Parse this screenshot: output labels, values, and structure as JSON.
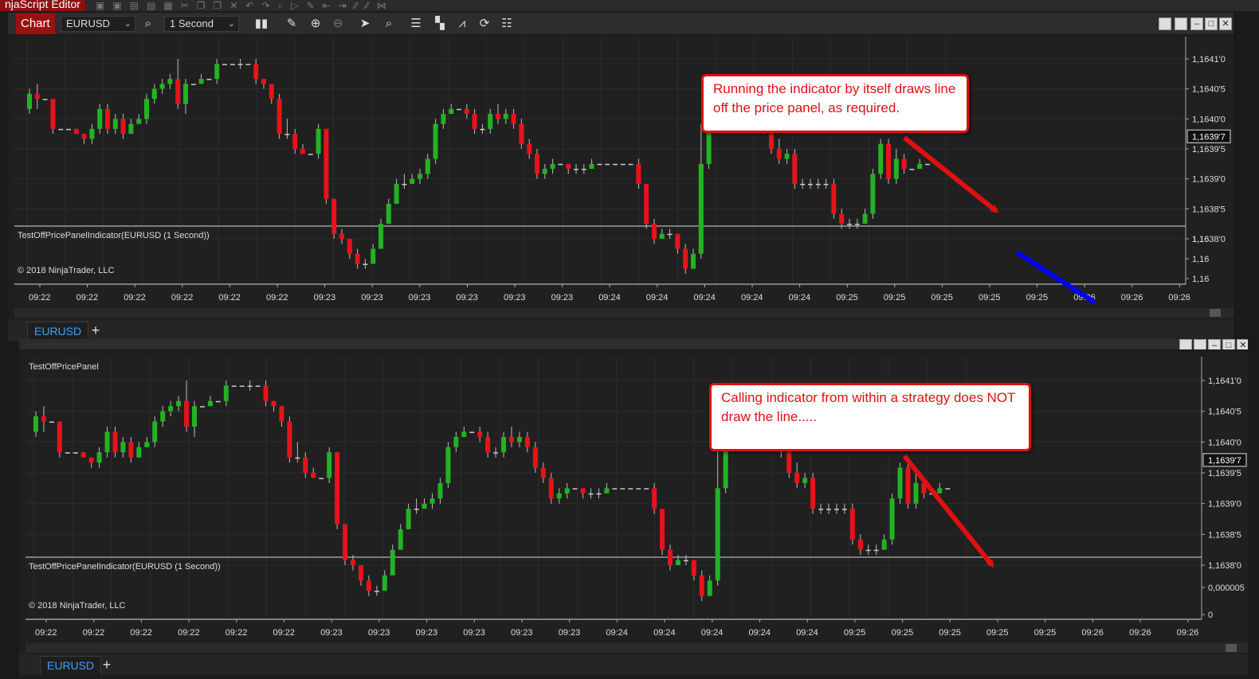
{
  "app": {
    "title": "njaScript Editor"
  },
  "colors": {
    "up": "#22b322",
    "down": "#e8121a",
    "panel": "#202020",
    "accent": "#3ea0ff",
    "annotation": "#e01010",
    "line": "#0000ff"
  },
  "toolbar": {
    "chart_label": "Chart",
    "instrument": "EURUSD",
    "interval": "1 Second",
    "icons": [
      "search-icon",
      "bars-icon",
      "pencil-icon",
      "zoom-in-icon",
      "zoom-out-icon",
      "pointer-icon",
      "data-box-icon",
      "properties-icon",
      "drawing-tools-icon",
      "indicators-icon",
      "refresh-icon",
      "list-icon"
    ],
    "window_buttons": [
      "tile-icon",
      "restore-icon",
      "minimize-icon",
      "maximize-icon",
      "close-icon"
    ]
  },
  "top_chart": {
    "price_labels": [
      "1,1641'0",
      "1,1640'5",
      "1,1640'0",
      "1,1639'5",
      "1,1639'0",
      "1,1638'5",
      "1,1638'0"
    ],
    "last_price": "1,1639'7",
    "indicator_label": "TestOffPricePanelIndicator(EURUSD (1 Second))",
    "indicator_axis": [
      "1,16",
      "1,16",
      "1,16"
    ],
    "copyright": "© 2018 NinjaTrader, LLC",
    "time_labels": [
      "09:22",
      "09:22",
      "09:22",
      "09:22",
      "09:22",
      "09:22",
      "09:23",
      "09:23",
      "09:23",
      "09:23",
      "09:23",
      "09:23",
      "09:24",
      "09:24",
      "09:24",
      "09:24",
      "09:24",
      "09:25",
      "09:25",
      "09:25",
      "09:25",
      "09:25",
      "09:26",
      "09:26",
      "09:26"
    ],
    "tab": "EURUSD",
    "callout": "Running the indicator by itself draws line off the price panel, as required."
  },
  "bottom_chart": {
    "panel_title": "TestOffPricePanel",
    "price_labels": [
      "1,1641'0",
      "1,1640'5",
      "1,1640'0",
      "1,1639'5",
      "1,1639'0",
      "1,1638'5",
      "1,1638'0"
    ],
    "last_price": "1,1639'7",
    "indicator_label": "TestOffPricePanelIndicator(EURUSD (1 Second))",
    "indicator_axis": [
      "0,000005",
      "0"
    ],
    "copyright": "© 2018 NinjaTrader, LLC",
    "time_labels": [
      "09:22",
      "09:22",
      "09:22",
      "09:22",
      "09:22",
      "09:22",
      "09:23",
      "09:23",
      "09:23",
      "09:23",
      "09:23",
      "09:23",
      "09:24",
      "09:24",
      "09:24",
      "09:24",
      "09:24",
      "09:25",
      "09:25",
      "09:25",
      "09:25",
      "09:25",
      "09:26",
      "09:26",
      "09:26"
    ],
    "tab": "EURUSD",
    "callout": "Calling indicator from within a strategy does NOT draw the line....."
  },
  "chart_data": {
    "type": "candlestick",
    "series_sequence": [
      [
        16,
        19,
        15,
        20
      ],
      [
        19,
        18,
        16,
        21
      ],
      [
        18,
        18,
        18,
        18
      ],
      [
        18,
        12,
        11,
        13
      ],
      [
        12,
        12,
        12,
        12
      ],
      [
        12,
        12,
        12,
        12
      ],
      [
        12,
        11,
        11,
        12
      ],
      [
        11,
        10,
        9,
        11
      ],
      [
        10,
        12,
        9,
        13
      ],
      [
        12,
        16,
        11,
        17
      ],
      [
        16,
        12,
        11,
        17
      ],
      [
        12,
        14,
        11,
        15
      ],
      [
        14,
        11,
        10,
        15
      ],
      [
        11,
        13,
        11,
        14
      ],
      [
        13,
        14,
        13,
        15
      ],
      [
        14,
        18,
        13,
        19
      ],
      [
        18,
        20,
        17,
        21
      ],
      [
        20,
        21,
        19,
        22
      ],
      [
        21,
        22,
        20,
        23
      ],
      [
        22,
        17,
        16,
        26
      ],
      [
        17,
        21,
        15,
        22
      ],
      [
        21,
        21,
        21,
        21
      ],
      [
        21,
        22,
        21,
        23
      ],
      [
        22,
        22,
        22,
        22
      ],
      [
        22,
        25,
        21,
        26
      ],
      [
        25,
        25,
        25,
        25
      ],
      [
        25,
        25,
        25,
        25
      ],
      [
        25,
        25,
        24,
        26
      ],
      [
        25,
        25,
        25,
        25
      ],
      [
        25,
        22,
        21,
        26
      ],
      [
        22,
        21,
        20,
        22
      ],
      [
        21,
        18,
        17,
        21
      ],
      [
        18,
        11,
        10,
        19
      ],
      [
        11,
        11,
        10,
        14
      ],
      [
        11,
        8,
        7,
        12
      ],
      [
        8,
        7,
        7,
        9
      ],
      [
        7,
        7,
        7,
        7
      ],
      [
        7,
        12,
        6,
        13
      ],
      [
        12,
        -2,
        -3,
        12
      ],
      [
        -2,
        -9,
        -10,
        -2
      ],
      [
        -9,
        -10,
        -11,
        -8
      ],
      [
        -10,
        -13,
        -14,
        -10
      ],
      [
        -13,
        -15,
        -16,
        -12
      ],
      [
        -15,
        -15,
        -16,
        -14
      ],
      [
        -15,
        -12,
        -13,
        -11
      ],
      [
        -12,
        -7,
        -8,
        -6
      ],
      [
        -7,
        -3,
        -4,
        -2
      ],
      [
        -3,
        1,
        -2,
        2
      ],
      [
        1,
        1,
        0,
        3
      ],
      [
        1,
        2,
        1,
        3
      ],
      [
        2,
        3,
        1,
        4
      ],
      [
        3,
        6,
        2,
        7
      ],
      [
        6,
        13,
        5,
        14
      ],
      [
        13,
        15,
        12,
        16
      ],
      [
        15,
        16,
        15,
        17
      ],
      [
        16,
        16,
        16,
        16
      ],
      [
        16,
        15,
        14,
        17
      ],
      [
        15,
        12,
        11,
        16
      ],
      [
        12,
        12,
        11,
        13
      ],
      [
        12,
        15,
        11,
        16
      ],
      [
        15,
        14,
        13,
        17
      ],
      [
        14,
        15,
        13,
        16
      ],
      [
        15,
        13,
        12,
        16
      ],
      [
        13,
        9,
        8,
        14
      ],
      [
        9,
        7,
        6,
        10
      ],
      [
        7,
        3,
        2,
        8
      ],
      [
        3,
        4,
        2,
        5
      ],
      [
        4,
        5,
        3,
        6
      ],
      [
        5,
        5,
        5,
        5
      ],
      [
        5,
        4,
        3,
        5
      ],
      [
        4,
        4,
        3,
        5
      ],
      [
        4,
        4,
        3,
        5
      ],
      [
        4,
        5,
        4,
        6
      ],
      [
        5,
        5,
        5,
        5
      ],
      [
        5,
        5,
        5,
        5
      ],
      [
        5,
        5,
        5,
        5
      ],
      [
        5,
        5,
        5,
        5
      ],
      [
        5,
        5,
        5,
        5
      ],
      [
        5,
        1,
        0,
        6
      ],
      [
        1,
        -7,
        -8,
        1
      ],
      [
        -7,
        -10,
        -11,
        -6
      ],
      [
        -10,
        -9,
        -10,
        -8
      ],
      [
        -9,
        -9,
        -10,
        -8
      ],
      [
        -9,
        -12,
        -13,
        -9
      ],
      [
        -12,
        -16,
        -17,
        -11
      ],
      [
        -16,
        -13,
        -14,
        -12
      ],
      [
        -13,
        5,
        -14,
        13
      ],
      [
        5,
        18,
        4,
        21
      ],
      [
        18,
        18,
        18,
        18
      ],
      [
        18,
        18,
        18,
        18
      ],
      [
        18,
        18,
        18,
        18
      ],
      [
        18,
        18,
        18,
        18
      ],
      [
        18,
        18,
        18,
        18
      ],
      [
        18,
        18,
        18,
        18
      ],
      [
        18,
        12,
        11,
        15
      ],
      [
        12,
        8,
        7,
        13
      ],
      [
        8,
        6,
        5,
        10
      ],
      [
        6,
        7,
        5,
        8
      ],
      [
        7,
        1,
        0,
        8
      ],
      [
        1,
        1,
        0,
        2
      ],
      [
        1,
        1,
        0,
        2
      ],
      [
        1,
        1,
        0,
        2
      ],
      [
        1,
        1,
        0,
        2
      ],
      [
        1,
        -5,
        -6,
        2
      ],
      [
        -5,
        -7,
        -8,
        -4
      ],
      [
        -7,
        -7,
        -8,
        -6
      ],
      [
        -7,
        -7,
        -8,
        -6
      ],
      [
        -7,
        -5,
        -6,
        -4
      ],
      [
        -5,
        3,
        -6,
        4
      ],
      [
        3,
        9,
        2,
        10
      ],
      [
        9,
        2,
        1,
        10
      ],
      [
        2,
        6,
        1,
        8
      ],
      [
        6,
        4,
        3,
        7
      ],
      [
        4,
        4,
        4,
        4
      ],
      [
        4,
        5,
        4,
        6
      ],
      [
        5,
        5,
        5,
        5
      ]
    ],
    "value_scale": "ticks relative to 1,1638'0 (ylim -10 to 26)",
    "ylim": [
      -10,
      26
    ]
  }
}
